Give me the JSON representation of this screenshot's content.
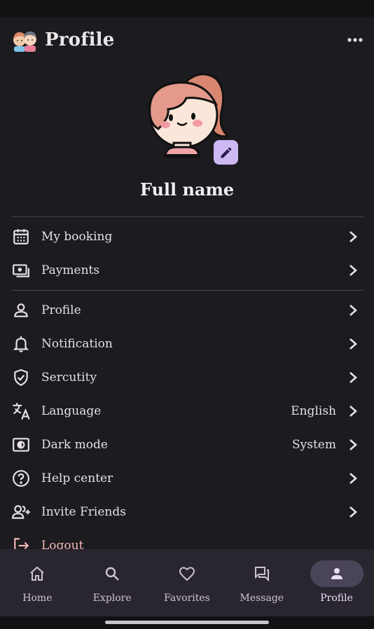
{
  "app_bar": {
    "title": "Profile",
    "logo_icon": "couple-avatar-logo",
    "more_icon": "more-horiz-icon"
  },
  "profile": {
    "avatar_icon": "girl-avatar-illustration",
    "edit_icon": "pencil-icon",
    "full_name": "Full name"
  },
  "menu": {
    "group1": [
      {
        "icon": "calendar-icon",
        "label": "My booking",
        "value": ""
      },
      {
        "icon": "payments-icon",
        "label": "Payments",
        "value": ""
      }
    ],
    "group2": [
      {
        "icon": "person-icon",
        "label": "Profile",
        "value": ""
      },
      {
        "icon": "bell-icon",
        "label": "Notification",
        "value": ""
      },
      {
        "icon": "shield-check-icon",
        "label": "Sercutity",
        "value": ""
      },
      {
        "icon": "translate-icon",
        "label": "Language",
        "value": "English"
      },
      {
        "icon": "dark-mode-icon",
        "label": "Dark mode",
        "value": "System"
      },
      {
        "icon": "help-circle-icon",
        "label": "Help center",
        "value": ""
      },
      {
        "icon": "person-add-icon",
        "label": "Invite Friends",
        "value": ""
      },
      {
        "icon": "logout-icon",
        "label": "Logout",
        "value": ""
      }
    ]
  },
  "bottom_nav": [
    {
      "icon": "home-icon",
      "label": "Home",
      "active": false
    },
    {
      "icon": "search-icon",
      "label": "Explore",
      "active": false
    },
    {
      "icon": "heart-icon",
      "label": "Favorites",
      "active": false
    },
    {
      "icon": "forum-icon",
      "label": "Message",
      "active": false
    },
    {
      "icon": "person-icon",
      "label": "Profile",
      "active": true
    }
  ],
  "colors": {
    "background": "#1c1b1f",
    "nav_background": "#2a2630",
    "accent": "#cdb8f4",
    "logout": "#f2b8b5"
  }
}
